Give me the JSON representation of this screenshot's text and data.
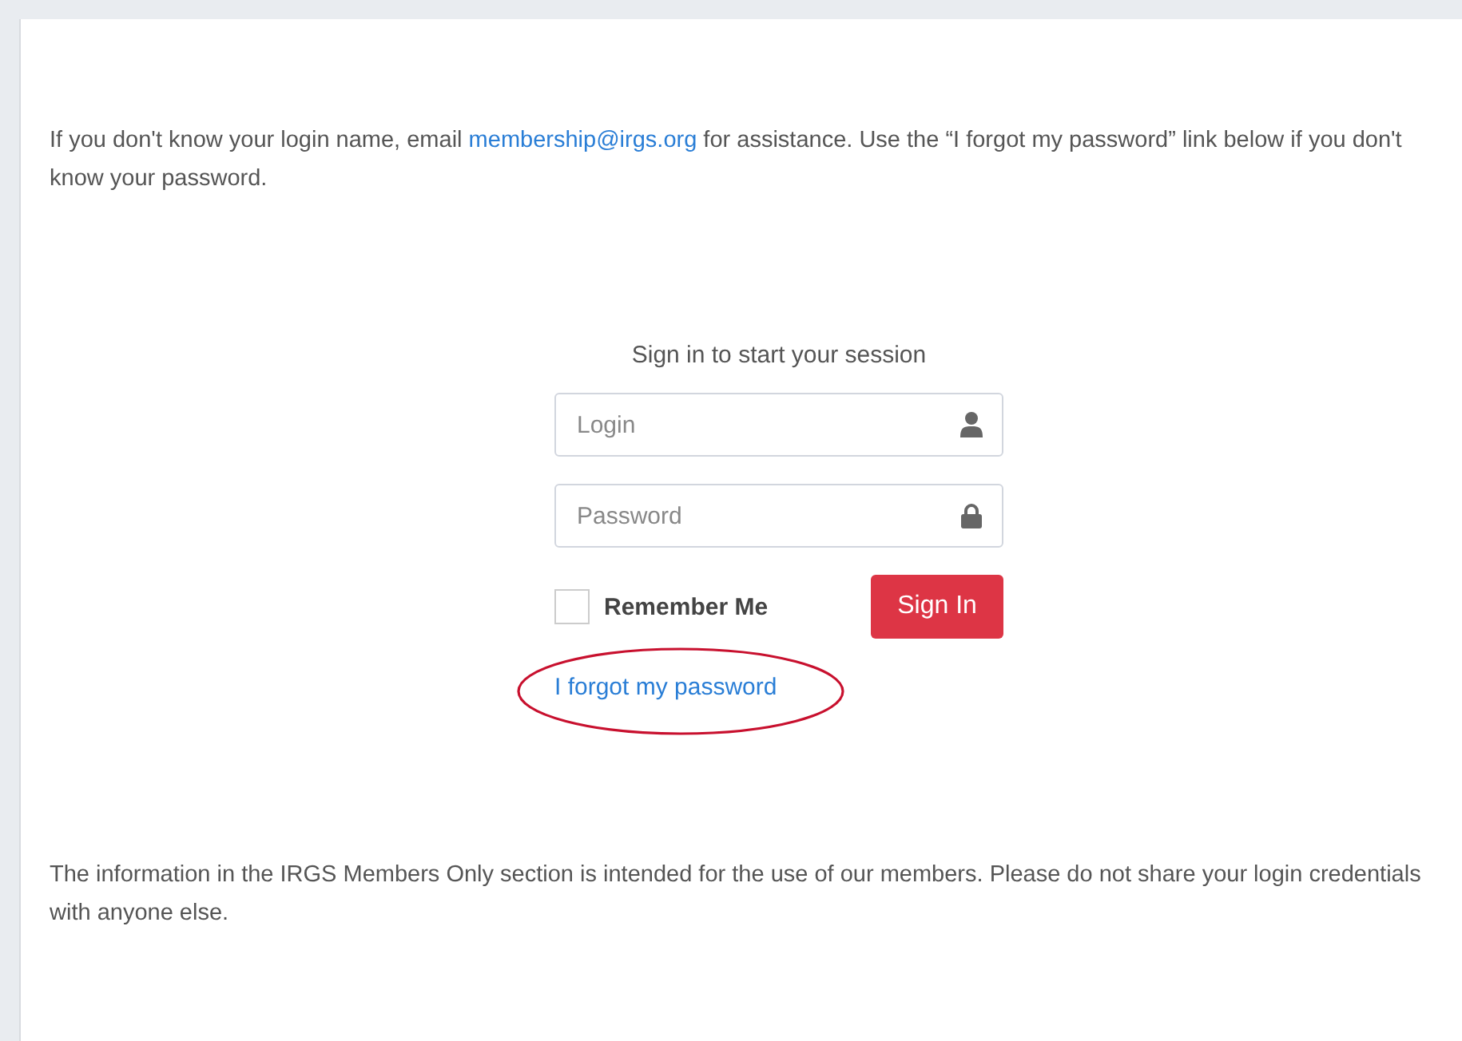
{
  "intro": {
    "before": "If you don't know your login name, email ",
    "link": "membership@irgs.org",
    "after": " for assistance.  Use the “I forgot my password” link below if you don't know your password."
  },
  "login_box": {
    "message": "Sign in to start your session",
    "fields": [
      {
        "kind": "user",
        "placeholder": "Login"
      },
      {
        "kind": "password",
        "placeholder": "Password"
      }
    ],
    "remember": {
      "label": "Remember Me",
      "checked": false
    },
    "submit": "Sign In",
    "forgot_link": {
      "label": "I forgot my password",
      "circled": true
    }
  },
  "footer_note": "The information in the IRGS Members Only section is intended for the use of our members. Please do not share your login credentials with anyone else."
}
